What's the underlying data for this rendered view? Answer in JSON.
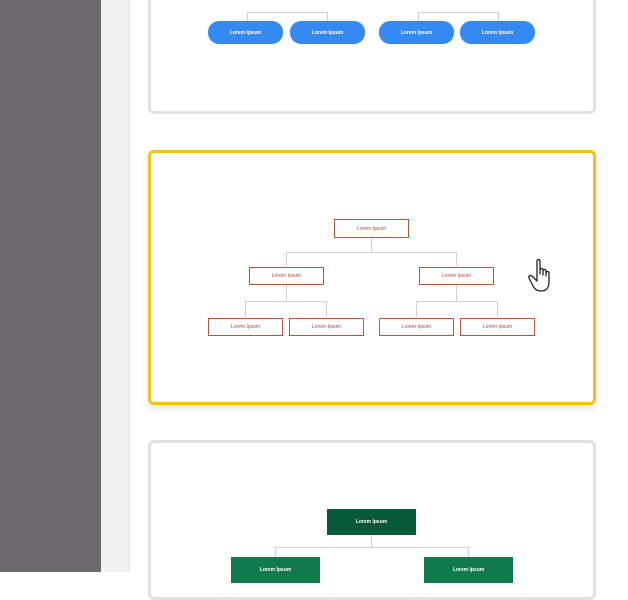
{
  "cards": [
    {
      "id": "blue-pill-template",
      "nodes": [
        "Lorem Ipsum",
        "Lorem Ipsum",
        "Lorem Ipsum",
        "Lorem Ipsum"
      ],
      "accent": "#3489f2"
    },
    {
      "id": "outline-template",
      "selected": true,
      "root": "Lorem Ipsum",
      "level2": [
        "Lorem Ipsum",
        "Lorem Ipsum"
      ],
      "level3": [
        "Lorem Ipsum",
        "Lorem Ipsum",
        "Lorem Ipsum",
        "Lorem Ipsum"
      ],
      "accent": "#c0533e"
    },
    {
      "id": "green-template",
      "root": "Lorem Ipsum",
      "level2": [
        "Lorem Ipsum",
        "Lorem Ipsum"
      ],
      "root_color": "#06593a",
      "node_color": "#0f7a4c"
    }
  ],
  "colors": {
    "selection": "#f5c01a",
    "card_border": "#e2e2e4",
    "gutter": "#6c6a6c"
  },
  "cursor": {
    "icon": "hand-pointer-icon"
  }
}
